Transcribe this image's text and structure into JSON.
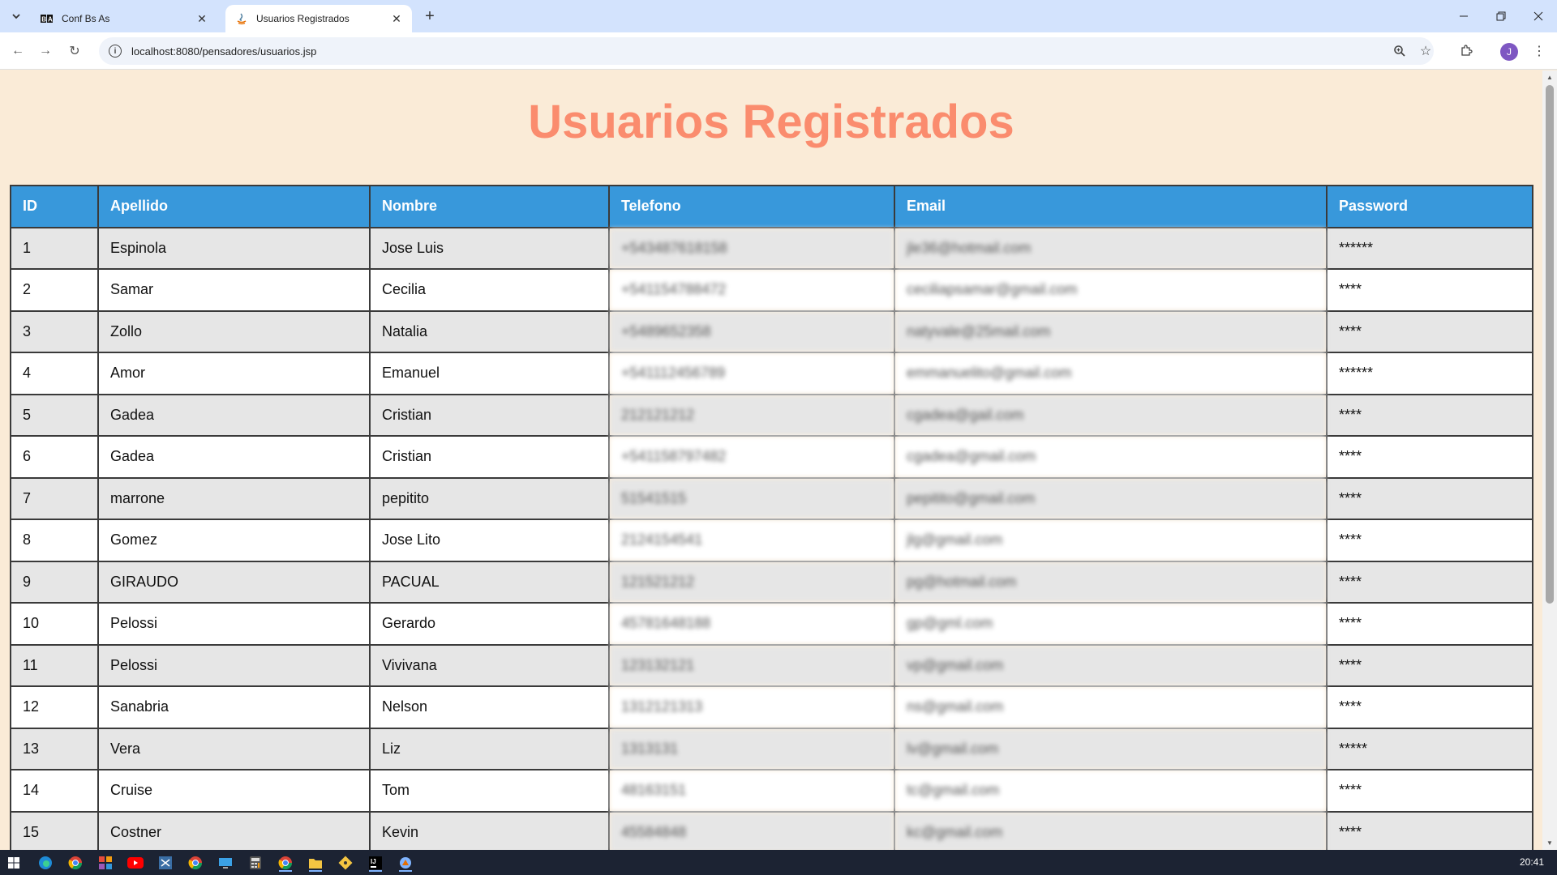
{
  "browser": {
    "tabs": [
      {
        "title": "Conf Bs As",
        "favicon": "ba-logo-icon",
        "active": false
      },
      {
        "title": "Usuarios Registrados",
        "favicon": "java-icon",
        "active": true
      }
    ],
    "url": "localhost:8080/pensadores/usuarios.jsp",
    "profile_initial": "J"
  },
  "page": {
    "title": "Usuarios Registrados",
    "columns": [
      "ID",
      "Apellido",
      "Nombre",
      "Telefono",
      "Email",
      "Password"
    ],
    "rows": [
      {
        "id": "1",
        "apellido": "Espinola",
        "nombre": "Jose Luis",
        "telefono": "+543487618158",
        "email": "jle36@hotmail.com",
        "password": "******"
      },
      {
        "id": "2",
        "apellido": "Samar",
        "nombre": "Cecilia",
        "telefono": "+541154788472",
        "email": "ceciliapsamar@gmail.com",
        "password": "****"
      },
      {
        "id": "3",
        "apellido": "Zollo",
        "nombre": "Natalia",
        "telefono": "+5489652358",
        "email": "natyvale@25mail.com",
        "password": "****"
      },
      {
        "id": "4",
        "apellido": "Amor",
        "nombre": "Emanuel",
        "telefono": "+541112456789",
        "email": "emmanuelito@gmail.com",
        "password": "******"
      },
      {
        "id": "5",
        "apellido": "Gadea",
        "nombre": "Cristian",
        "telefono": "212121212",
        "email": "cgadea@gail.com",
        "password": "****"
      },
      {
        "id": "6",
        "apellido": "Gadea",
        "nombre": "Cristian",
        "telefono": "+541158797482",
        "email": "cgadea@gmail.com",
        "password": "****"
      },
      {
        "id": "7",
        "apellido": "marrone",
        "nombre": "pepitito",
        "telefono": "51541515",
        "email": "pepitito@gmail.com",
        "password": "****"
      },
      {
        "id": "8",
        "apellido": "Gomez",
        "nombre": "Jose Lito",
        "telefono": "2124154541",
        "email": "jlg@gmail.com",
        "password": "****"
      },
      {
        "id": "9",
        "apellido": "GIRAUDO",
        "nombre": "PACUAL",
        "telefono": "121521212",
        "email": "pg@hotmail.com",
        "password": "****"
      },
      {
        "id": "10",
        "apellido": "Pelossi",
        "nombre": "Gerardo",
        "telefono": "45781648188",
        "email": "gp@gml.com",
        "password": "****"
      },
      {
        "id": "11",
        "apellido": "Pelossi",
        "nombre": "Vivivana",
        "telefono": "123132121",
        "email": "vp@gmail.com",
        "password": "****"
      },
      {
        "id": "12",
        "apellido": "Sanabria",
        "nombre": "Nelson",
        "telefono": "1312121313",
        "email": "ns@gmail.com",
        "password": "****"
      },
      {
        "id": "13",
        "apellido": "Vera",
        "nombre": "Liz",
        "telefono": "1313131",
        "email": "lv@gmail.com",
        "password": "*****"
      },
      {
        "id": "14",
        "apellido": "Cruise",
        "nombre": "Tom",
        "telefono": "48163151",
        "email": "tc@gmail.com",
        "password": "****"
      },
      {
        "id": "15",
        "apellido": "Costner",
        "nombre": "Kevin",
        "telefono": "45584848",
        "email": "kc@gmail.com",
        "password": "****"
      }
    ]
  },
  "taskbar": {
    "clock": "20:41",
    "apps": [
      "windows-start-icon",
      "edge-icon",
      "chrome-icon",
      "office-icon",
      "youtube-icon",
      "visual-studio-icon",
      "chrome-icon",
      "remote-desktop-icon",
      "calculator-icon",
      "chrome-icon",
      "file-explorer-icon",
      "git-icon",
      "intellij-icon",
      "app-icon"
    ]
  },
  "colors": {
    "page_bg": "#faebd7",
    "title": "#fa8c6e",
    "header_bg": "#3898db",
    "row_odd": "#e6e6e6",
    "row_even": "#ffffff"
  }
}
